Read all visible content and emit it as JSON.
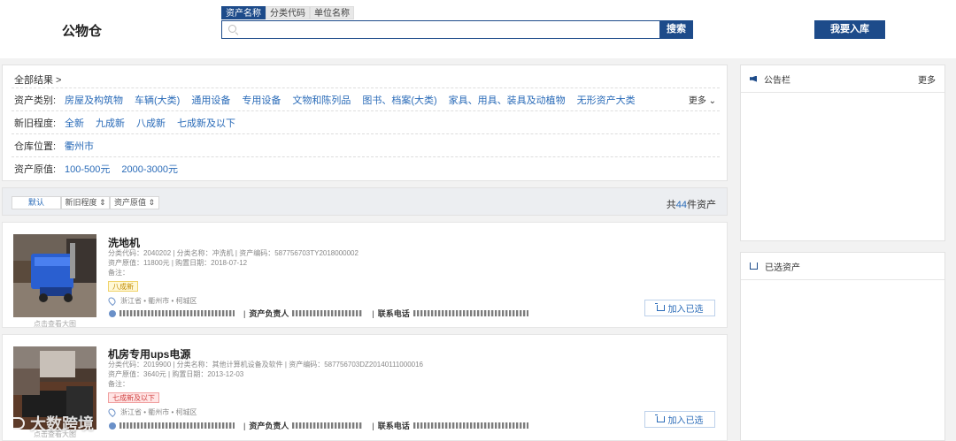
{
  "header": {
    "logo": "公物仓",
    "search_tabs": [
      "资产名称",
      "分类代码",
      "单位名称"
    ],
    "search_placeholder": "",
    "search_button": "搜索",
    "stock_in_button": "我要入库"
  },
  "filters": {
    "breadcrumb": "全部结果 >",
    "more": "更多 ⌄",
    "rows": [
      {
        "label": "资产类别:",
        "options": [
          "房屋及构筑物",
          "车辆(大类)",
          "通用设备",
          "专用设备",
          "文物和陈列品",
          "图书、档案(大类)",
          "家具、用具、装具及动植物",
          "无形资产大类"
        ]
      },
      {
        "label": "新旧程度:",
        "options": [
          "全新",
          "九成新",
          "八成新",
          "七成新及以下"
        ]
      },
      {
        "label": "仓库位置:",
        "options": [
          "衢州市"
        ]
      },
      {
        "label": "资产原值:",
        "options": [
          "100-500元",
          "2000-3000元"
        ]
      }
    ]
  },
  "sort": {
    "default": "默认",
    "condition": "新旧程度 ⇕",
    "value": "资产原值 ⇕",
    "total_prefix": "共",
    "total_count": "44",
    "total_suffix": "件资产"
  },
  "assets": [
    {
      "title": "洗地机",
      "meta1": "分类代码：2040202 | 分类名称：冲洗机 | 资产编码：587756703TY2018000002",
      "meta2": "资产原值：11800元 | 购置日期：2018-07-12",
      "meta3": "备注：",
      "badge": "八成新",
      "location": "浙江省 • 衢州市 • 柯城区",
      "owner_label": "资产负责人",
      "phone_label": "联系电话",
      "photo_caption": "点击查看大图",
      "add_button": "加入已选"
    },
    {
      "title": "机房专用ups电源",
      "meta1": "分类代码：2019900 | 分类名称：其他计算机设备及软件 | 资产编码：587756703DZ20140111000016",
      "meta2": "资产原值：3640元 | 购置日期：2013-12-03",
      "meta3": "备注：",
      "badge": "七成新及以下",
      "location": "浙江省 • 衢州市 • 柯城区",
      "owner_label": "资产负责人",
      "phone_label": "联系电话",
      "photo_caption": "点击查看大图",
      "add_button": "加入已选"
    }
  ],
  "sidebar": {
    "notice_title": "公告栏",
    "notice_more": "更多",
    "selected_title": "已选资产"
  },
  "watermark": "大数跨境"
}
